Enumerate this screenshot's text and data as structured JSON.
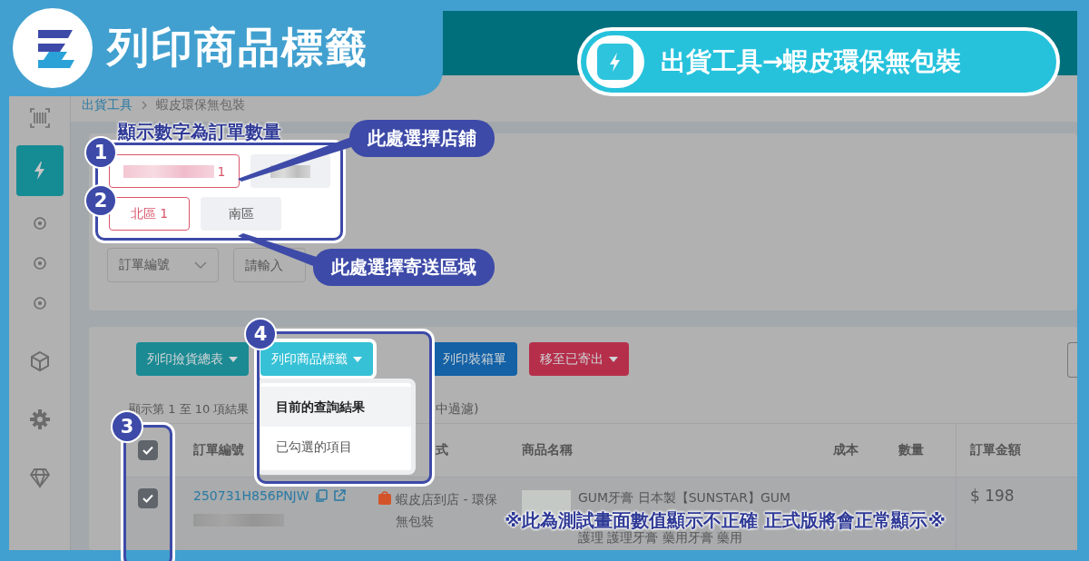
{
  "banner": {
    "title": "列印商品標籤"
  },
  "path_pill": {
    "text": "出貨工具→蝦皮環保無包裝"
  },
  "breadcrumb": [
    "出貨工具",
    "蝦皮環保無包裝"
  ],
  "sidebar": {
    "items": [
      {
        "kind": "barcode",
        "selected": false
      },
      {
        "kind": "bolt",
        "selected": true
      },
      {
        "kind": "target",
        "selected": false
      },
      {
        "kind": "target",
        "selected": false
      },
      {
        "kind": "target",
        "selected": false
      },
      {
        "kind": "cube",
        "selected": false
      },
      {
        "kind": "gear",
        "selected": false
      },
      {
        "kind": "diamond",
        "selected": false
      }
    ]
  },
  "stores": [
    {
      "count": "1",
      "selected": true
    },
    {
      "selected": false
    }
  ],
  "regions": [
    {
      "label": "北區 1",
      "selected": true
    },
    {
      "label": "南區",
      "selected": false
    }
  ],
  "filters": [
    {
      "kind": "select",
      "value": "訂單編號"
    },
    {
      "kind": "input",
      "placeholder": "請輸入"
    }
  ],
  "toolbar": [
    {
      "label": "列印撿貨總表",
      "kind": "success",
      "dropdown": true,
      "expanded": false
    },
    {
      "label": "列印商品標籤",
      "kind": "info",
      "dropdown": true,
      "expanded": true,
      "menu": [
        {
          "label": "目前的查詢結果",
          "selected": true
        },
        {
          "label": "已勾選的項目",
          "selected": false
        }
      ]
    },
    {
      "label": "列印裝箱單",
      "kind": "primary",
      "dropdown": false,
      "expanded": false
    },
    {
      "label": "移至已寄出",
      "kind": "danger",
      "dropdown": true,
      "expanded": false
    }
  ],
  "info_text": [
    "顯示第 1 至 10 項結果",
    "中過濾)"
  ],
  "table": {
    "header_checked": true,
    "columns": [
      "訂單編號",
      "式",
      "商品名稱",
      "成本",
      "數量",
      "訂單金額"
    ],
    "rows": [
      {
        "checked": true,
        "order_no": "250731H856PNJW",
        "shipping": "蝦皮店到店 - 環保無包裝",
        "product_lines": [
          "GUM牙膏 日本製【SUNSTAR】GUM",
          "護理 護理牙膏 藥用牙膏 藥用"
        ],
        "amount": "$ 198"
      }
    ]
  },
  "annotations": {
    "caption": "顯示數字為訂單數量",
    "callouts": [
      "此處選擇店鋪",
      "此處選擇寄送區域"
    ],
    "badges": [
      "1",
      "2",
      "3",
      "4"
    ]
  },
  "notice": "※此為測試畫面數值顯示不正確 正式版將會正常顯示※"
}
